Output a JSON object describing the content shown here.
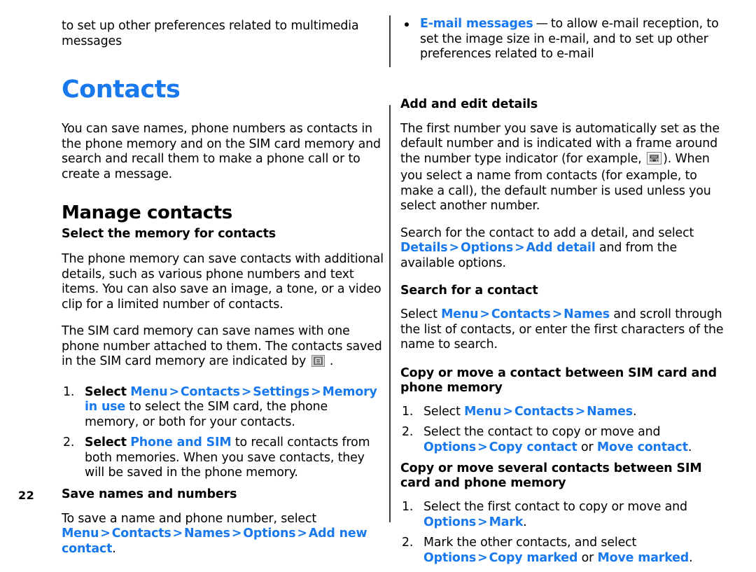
{
  "page": {
    "number": "22",
    "chapter_title": "Contacts",
    "accent_color": "#1878ec",
    "text_color": "#000000",
    "background_color": "#ffffff"
  },
  "left_column": {
    "continued_bullet": {
      "text": "to set up other preferences related to multimedia messages"
    },
    "intro_paragraph": "You can save names, phone numbers as contacts in the phone memory and on the SIM card memory and search and recall them to make a phone call or to create a message.",
    "section_title": "Manage contacts",
    "subsections": [
      {
        "title": "Select the memory for contacts",
        "paragraphs": [
          "The phone memory can save contacts with additional details, such as various phone numbers and text items. You can also save an image, a tone, or a video clip for a limited number of contacts.",
          "The SIM card memory can save names with one phone number attached to them. The contacts saved in the SIM card memory are indicated by"
        ],
        "sim_icon_trailing": ".",
        "steps": [
          {
            "lead": "Select",
            "path": [
              "Menu",
              "Contacts",
              "Settings",
              "Memory in use"
            ],
            "tail": "to select the SIM card, the phone memory, or both for your contacts."
          },
          {
            "lead": "Select",
            "path": [
              "Phone and SIM"
            ],
            "tail": "to recall contacts from both memories. When you save contacts, they will be saved in the phone memory."
          }
        ]
      },
      {
        "title": "Save names and numbers",
        "save_lead": "To save a name and phone number, select",
        "save_path": [
          "Menu",
          "Contacts",
          "Names",
          "Options",
          "Add new contact"
        ],
        "save_tail": "."
      }
    ]
  },
  "right_column": {
    "continued_bullet": {
      "label": "E-mail messages",
      "dash": "—",
      "text": "to allow e-mail reception, to set the image size in e-mail, and to set up other preferences related to e-mail"
    },
    "subsections": [
      {
        "title": "Add and edit details",
        "paragraph_a": "The first number you save is automatically set as the default number and is indicated with a frame around the number type indicator (for example,",
        "paragraph_b": "). When you select a name from contacts (for example, to make a call), the default number is used unless you select another number.",
        "search_lead": "Search for the contact to add a detail, and select",
        "search_path": [
          "Details",
          "Options",
          "Add detail"
        ],
        "search_tail": "and from the available options."
      },
      {
        "title": "Search for a contact",
        "lead": "Select",
        "path": [
          "Menu",
          "Contacts",
          "Names"
        ],
        "tail": "and scroll through the list of contacts, or enter the first characters of the name to search."
      },
      {
        "title": "Copy or move a contact between SIM card and phone memory",
        "steps": [
          {
            "lead": "Select",
            "path": [
              "Menu",
              "Contacts",
              "Names"
            ],
            "tail": "."
          },
          {
            "lead": "Select the contact to copy or move and",
            "path": [
              "Options",
              "Copy contact"
            ],
            "or_word": "or",
            "alt": "Move contact",
            "tail": "."
          }
        ]
      },
      {
        "title": "Copy or move several contacts between SIM card and phone memory",
        "steps": [
          {
            "lead": "Select the first contact to copy or move and",
            "path": [
              "Options",
              "Mark"
            ],
            "tail": "."
          },
          {
            "lead": "Mark the other contacts, and select",
            "path": [
              "Options",
              "Copy marked"
            ],
            "or_word": "or",
            "alt": "Move marked",
            "tail": "."
          }
        ]
      }
    ]
  },
  "icons": {
    "sim_card": "sim-card-icon",
    "number_type_indicator": "number-type-indicator-icon"
  },
  "separators": {
    "chevron": ">"
  }
}
